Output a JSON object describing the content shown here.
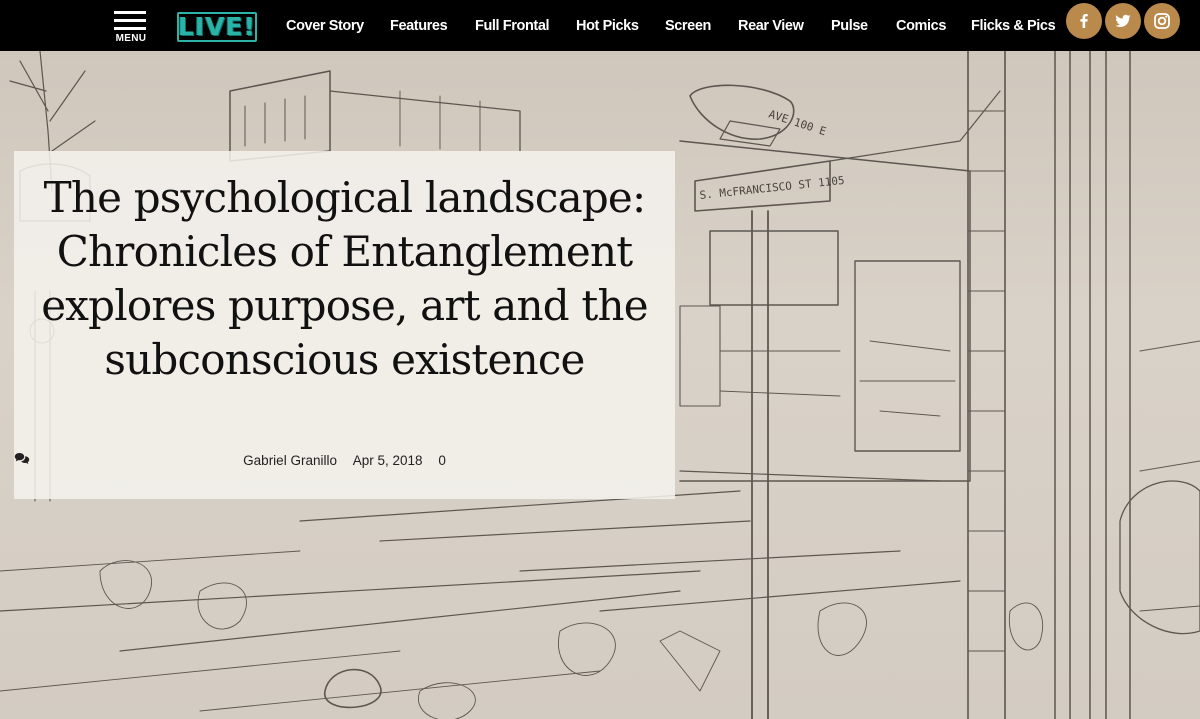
{
  "nav": {
    "menu_label": "MENU",
    "logo_text": "LIVE!",
    "items": [
      {
        "label": "Cover Story"
      },
      {
        "label": "Features"
      },
      {
        "label": "Full Frontal"
      },
      {
        "label": "Hot Picks"
      },
      {
        "label": "Screen"
      },
      {
        "label": "Rear View"
      },
      {
        "label": "Pulse"
      },
      {
        "label": "Comics"
      },
      {
        "label": "Flicks & Pics"
      }
    ],
    "social": [
      {
        "icon": "facebook-icon"
      },
      {
        "icon": "twitter-icon"
      },
      {
        "icon": "instagram-icon"
      }
    ]
  },
  "article": {
    "headline": "The psychological landscape: Chronicles of Entanglement explores purpose, art and the subconscious existence",
    "author": "Gabriel Granillo",
    "date": "Apr 5, 2018",
    "comment_count": "0"
  },
  "hero": {
    "sign_text_1": "AVE 100 E",
    "sign_text_2": "S. McFRANCISCO ST 1105"
  },
  "colors": {
    "nav_background": "#000000",
    "logo_accent": "#2bb3a8",
    "social_circle": "#b98a4c",
    "card_background": "#f4f2ee"
  }
}
